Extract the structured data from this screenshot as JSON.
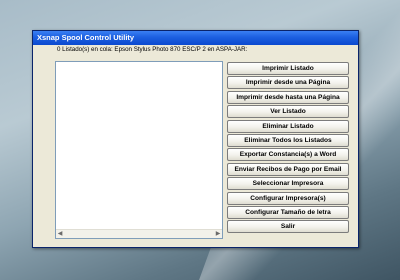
{
  "window": {
    "title": "Xsnap Spool Control Utility"
  },
  "status_text": "0 Listado(s) en cola: Epson Stylus Photo 870 ESC/P 2 en ASPA-JAR:",
  "buttons": [
    {
      "label": "Imprimir Listado"
    },
    {
      "label": "Imprimir desde una Página"
    },
    {
      "label": "Imprimir desde hasta una Página"
    },
    {
      "label": "Ver Listado"
    },
    {
      "label": "Eliminar Listado"
    },
    {
      "label": "Eliminar Todos los Listados"
    },
    {
      "label": "Exportar Constancia(s) a Word"
    },
    {
      "label": "Enviar Recibos de Pago por Email"
    },
    {
      "label": "Seleccionar Impresora"
    },
    {
      "label": "Configurar Impresora(s)"
    },
    {
      "label": "Configurar Tamaño de letra"
    },
    {
      "label": "Salir"
    }
  ]
}
